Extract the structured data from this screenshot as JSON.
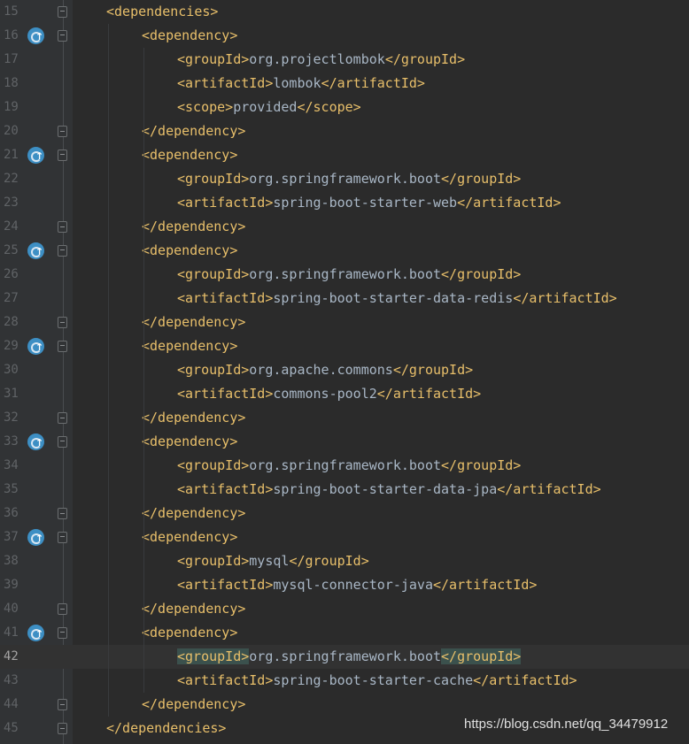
{
  "watermark": "https://blog.csdn.net/qq_34479912",
  "current_line": 42,
  "lines": [
    {
      "num": "15",
      "indent": 1,
      "parts": [
        {
          "t": "tag",
          "v": "<dependencies>"
        }
      ],
      "fold": "open",
      "marker": false
    },
    {
      "num": "16",
      "indent": 2,
      "parts": [
        {
          "t": "tag",
          "v": "<dependency>"
        }
      ],
      "fold": "open",
      "marker": true
    },
    {
      "num": "17",
      "indent": 3,
      "parts": [
        {
          "t": "tag",
          "v": "<groupId>"
        },
        {
          "t": "txt",
          "v": "org.projectlombok"
        },
        {
          "t": "tag",
          "v": "</groupId>"
        }
      ],
      "fold": "",
      "marker": false
    },
    {
      "num": "18",
      "indent": 3,
      "parts": [
        {
          "t": "tag",
          "v": "<artifactId>"
        },
        {
          "t": "txt",
          "v": "lombok"
        },
        {
          "t": "tag",
          "v": "</artifactId>"
        }
      ],
      "fold": "",
      "marker": false
    },
    {
      "num": "19",
      "indent": 3,
      "parts": [
        {
          "t": "tag",
          "v": "<scope>"
        },
        {
          "t": "txt",
          "v": "provided"
        },
        {
          "t": "tag",
          "v": "</scope>"
        }
      ],
      "fold": "",
      "marker": false
    },
    {
      "num": "20",
      "indent": 2,
      "parts": [
        {
          "t": "tag",
          "v": "</dependency>"
        }
      ],
      "fold": "close",
      "marker": false
    },
    {
      "num": "21",
      "indent": 2,
      "parts": [
        {
          "t": "tag",
          "v": "<dependency>"
        }
      ],
      "fold": "open",
      "marker": true
    },
    {
      "num": "22",
      "indent": 3,
      "parts": [
        {
          "t": "tag",
          "v": "<groupId>"
        },
        {
          "t": "txt",
          "v": "org.springframework.boot"
        },
        {
          "t": "tag",
          "v": "</groupId>"
        }
      ],
      "fold": "",
      "marker": false
    },
    {
      "num": "23",
      "indent": 3,
      "parts": [
        {
          "t": "tag",
          "v": "<artifactId>"
        },
        {
          "t": "txt",
          "v": "spring-boot-starter-web"
        },
        {
          "t": "tag",
          "v": "</artifactId>"
        }
      ],
      "fold": "",
      "marker": false
    },
    {
      "num": "24",
      "indent": 2,
      "parts": [
        {
          "t": "tag",
          "v": "</dependency>"
        }
      ],
      "fold": "close",
      "marker": false
    },
    {
      "num": "25",
      "indent": 2,
      "parts": [
        {
          "t": "tag",
          "v": "<dependency>"
        }
      ],
      "fold": "open",
      "marker": true
    },
    {
      "num": "26",
      "indent": 3,
      "parts": [
        {
          "t": "tag",
          "v": "<groupId>"
        },
        {
          "t": "txt",
          "v": "org.springframework.boot"
        },
        {
          "t": "tag",
          "v": "</groupId>"
        }
      ],
      "fold": "",
      "marker": false
    },
    {
      "num": "27",
      "indent": 3,
      "parts": [
        {
          "t": "tag",
          "v": "<artifactId>"
        },
        {
          "t": "txt",
          "v": "spring-boot-starter-data-redis"
        },
        {
          "t": "tag",
          "v": "</artifactId>"
        }
      ],
      "fold": "",
      "marker": false
    },
    {
      "num": "28",
      "indent": 2,
      "parts": [
        {
          "t": "tag",
          "v": "</dependency>"
        }
      ],
      "fold": "close",
      "marker": false
    },
    {
      "num": "29",
      "indent": 2,
      "parts": [
        {
          "t": "tag",
          "v": "<dependency>"
        }
      ],
      "fold": "open",
      "marker": true
    },
    {
      "num": "30",
      "indent": 3,
      "parts": [
        {
          "t": "tag",
          "v": "<groupId>"
        },
        {
          "t": "txt",
          "v": "org.apache.commons"
        },
        {
          "t": "tag",
          "v": "</groupId>"
        }
      ],
      "fold": "",
      "marker": false
    },
    {
      "num": "31",
      "indent": 3,
      "parts": [
        {
          "t": "tag",
          "v": "<artifactId>"
        },
        {
          "t": "txt",
          "v": "commons-pool2"
        },
        {
          "t": "tag",
          "v": "</artifactId>"
        }
      ],
      "fold": "",
      "marker": false
    },
    {
      "num": "32",
      "indent": 2,
      "parts": [
        {
          "t": "tag",
          "v": "</dependency>"
        }
      ],
      "fold": "close",
      "marker": false
    },
    {
      "num": "33",
      "indent": 2,
      "parts": [
        {
          "t": "tag",
          "v": "<dependency>"
        }
      ],
      "fold": "open",
      "marker": true
    },
    {
      "num": "34",
      "indent": 3,
      "parts": [
        {
          "t": "tag",
          "v": "<groupId>"
        },
        {
          "t": "txt",
          "v": "org.springframework.boot"
        },
        {
          "t": "tag",
          "v": "</groupId>"
        }
      ],
      "fold": "",
      "marker": false
    },
    {
      "num": "35",
      "indent": 3,
      "parts": [
        {
          "t": "tag",
          "v": "<artifactId>"
        },
        {
          "t": "txt",
          "v": "spring-boot-starter-data-jpa"
        },
        {
          "t": "tag",
          "v": "</artifactId>"
        }
      ],
      "fold": "",
      "marker": false
    },
    {
      "num": "36",
      "indent": 2,
      "parts": [
        {
          "t": "tag",
          "v": "</dependency>"
        }
      ],
      "fold": "close",
      "marker": false
    },
    {
      "num": "37",
      "indent": 2,
      "parts": [
        {
          "t": "tag",
          "v": "<dependency>"
        }
      ],
      "fold": "open",
      "marker": true
    },
    {
      "num": "38",
      "indent": 3,
      "parts": [
        {
          "t": "tag",
          "v": "<groupId>"
        },
        {
          "t": "txt",
          "v": "mysql"
        },
        {
          "t": "tag",
          "v": "</groupId>"
        }
      ],
      "fold": "",
      "marker": false
    },
    {
      "num": "39",
      "indent": 3,
      "parts": [
        {
          "t": "tag",
          "v": "<artifactId>"
        },
        {
          "t": "txt",
          "v": "mysql-connector-java"
        },
        {
          "t": "tag",
          "v": "</artifactId>"
        }
      ],
      "fold": "",
      "marker": false
    },
    {
      "num": "40",
      "indent": 2,
      "parts": [
        {
          "t": "tag",
          "v": "</dependency>"
        }
      ],
      "fold": "close",
      "marker": false
    },
    {
      "num": "41",
      "indent": 2,
      "parts": [
        {
          "t": "tag",
          "v": "<dependency>"
        }
      ],
      "fold": "open",
      "marker": true
    },
    {
      "num": "42",
      "indent": 3,
      "parts": [
        {
          "t": "tag",
          "v": "<groupId>",
          "hl": true
        },
        {
          "t": "txt",
          "v": "org.springframework.boot"
        },
        {
          "t": "tag",
          "v": "</groupId>",
          "hl": true
        }
      ],
      "fold": "",
      "marker": false
    },
    {
      "num": "43",
      "indent": 3,
      "parts": [
        {
          "t": "tag",
          "v": "<artifactId>"
        },
        {
          "t": "txt",
          "v": "spring-boot-starter-cache"
        },
        {
          "t": "tag",
          "v": "</artifactId>"
        }
      ],
      "fold": "",
      "marker": false
    },
    {
      "num": "44",
      "indent": 2,
      "parts": [
        {
          "t": "tag",
          "v": "</dependency>"
        }
      ],
      "fold": "close",
      "marker": false
    },
    {
      "num": "45",
      "indent": 1,
      "parts": [
        {
          "t": "tag",
          "v": "</dependencies>"
        }
      ],
      "fold": "close",
      "marker": false
    }
  ]
}
